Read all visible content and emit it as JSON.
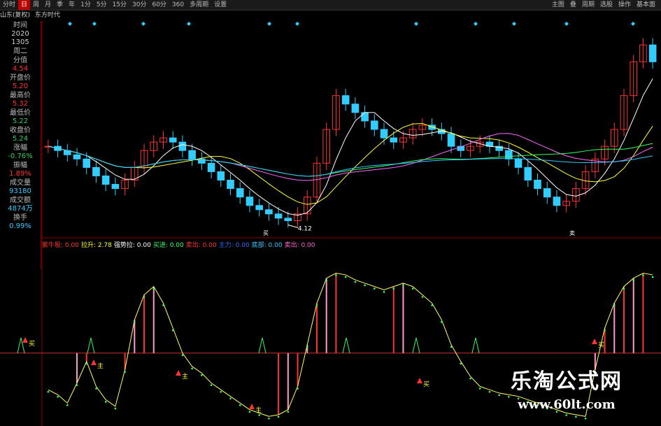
{
  "toolbar": {
    "tabs": [
      "分时",
      "日",
      "周",
      "月",
      "季",
      "年",
      "1分",
      "5分",
      "15分",
      "30分",
      "60分",
      "360",
      "多周期",
      "设置"
    ],
    "selected_index": 1,
    "right_items": [
      "主图",
      "叠",
      "周期",
      "选股",
      "操作",
      "基本面"
    ]
  },
  "title": {
    "code": "山东(复权)",
    "name": "东方时代"
  },
  "info_panel": [
    {
      "label": "时间",
      "value": "2020",
      "color": "#cccccc"
    },
    {
      "label": "",
      "value": "1305",
      "color": "#cccccc"
    },
    {
      "label": "周二",
      "value": "",
      "color": "#cccccc"
    },
    {
      "label": "分值",
      "value": "4.54",
      "color": "#ff3333"
    },
    {
      "label": "开盘价",
      "value": "5.20",
      "color": "#ff3333"
    },
    {
      "label": "最高价",
      "value": "5.32",
      "color": "#ff3333"
    },
    {
      "label": "最低价",
      "value": "5.22",
      "color": "#33cc66"
    },
    {
      "label": "收盘价",
      "value": "5.24",
      "color": "#33cc66"
    },
    {
      "label": "涨幅",
      "value": "-0.76%",
      "color": "#33cc66"
    },
    {
      "label": "振幅",
      "value": "1.89%",
      "color": "#ff3333"
    },
    {
      "label": "成交量",
      "value": "93180",
      "color": "#33ccff"
    },
    {
      "label": "成交额",
      "value": "4874万",
      "color": "#33ccff"
    },
    {
      "label": "换手",
      "value": "0.99%",
      "color": "#33ccff"
    }
  ],
  "indicator_bar": [
    {
      "text": "紫牛股: 0.00",
      "color": "#ff3333"
    },
    {
      "text": "拉升: 2.78",
      "color": "#ffff33"
    },
    {
      "text": "强势拉: 0.00",
      "color": "#ffffff"
    },
    {
      "text": "买进: 0.00",
      "color": "#33ff66"
    },
    {
      "text": "卖出: 0.00",
      "color": "#ff3333"
    },
    {
      "text": "主力: 0.00",
      "color": "#3366ff"
    },
    {
      "text": "底部: 0.00",
      "color": "#33ccff"
    },
    {
      "text": "卖出: 0.00",
      "color": "#ff66cc"
    }
  ],
  "markers": {
    "low_label": "4.12",
    "buy_labels": [
      "买",
      "主",
      "主",
      "主",
      "买",
      "买"
    ],
    "buy_tag": "买",
    "sell_tag": "卖"
  },
  "colors": {
    "up": "#ff3333",
    "down": "#33ccff",
    "ma5": "#ffffff",
    "ma10": "#ffff33",
    "ma20": "#ff66ff",
    "ma30": "#33ff66",
    "ma60": "#33ccff",
    "indicator_line": "#ffff66",
    "indicator_dots": "#33ff66",
    "pink": "#ff99cc",
    "hline": "#cc3333"
  },
  "watermark": {
    "title": "乐淘公式网",
    "url": "www.60lt.com"
  },
  "chart_data": {
    "type": "candlestick",
    "price_closes": [
      5.0,
      4.95,
      4.9,
      4.85,
      4.75,
      4.65,
      4.55,
      4.5,
      4.6,
      4.75,
      4.95,
      5.05,
      5.1,
      5.05,
      4.95,
      4.85,
      4.8,
      4.7,
      4.6,
      4.5,
      4.4,
      4.3,
      4.25,
      4.2,
      4.15,
      4.12,
      4.2,
      4.4,
      4.8,
      5.2,
      5.6,
      5.5,
      5.4,
      5.3,
      5.2,
      5.1,
      5.05,
      5.1,
      5.2,
      5.25,
      5.2,
      5.15,
      5.0,
      4.95,
      5.0,
      5.05,
      5.0,
      4.95,
      4.85,
      4.75,
      4.6,
      4.5,
      4.4,
      4.3,
      4.35,
      4.5,
      4.7,
      4.85,
      5.0,
      5.2,
      5.6,
      6.0,
      6.2,
      6.0
    ],
    "indicator": [
      18,
      15,
      10,
      22,
      35,
      20,
      12,
      8,
      30,
      60,
      75,
      80,
      70,
      55,
      40,
      32,
      28,
      22,
      18,
      14,
      10,
      6,
      4,
      2,
      3,
      6,
      20,
      45,
      70,
      85,
      88,
      87,
      84,
      82,
      80,
      78,
      80,
      82,
      80,
      75,
      70,
      60,
      45,
      35,
      26,
      20,
      18,
      16,
      15,
      14,
      12,
      10,
      8,
      6,
      4,
      3,
      2,
      30,
      55,
      70,
      80,
      85,
      88,
      87
    ],
    "hline_level": 40,
    "low_price": 4.12
  }
}
